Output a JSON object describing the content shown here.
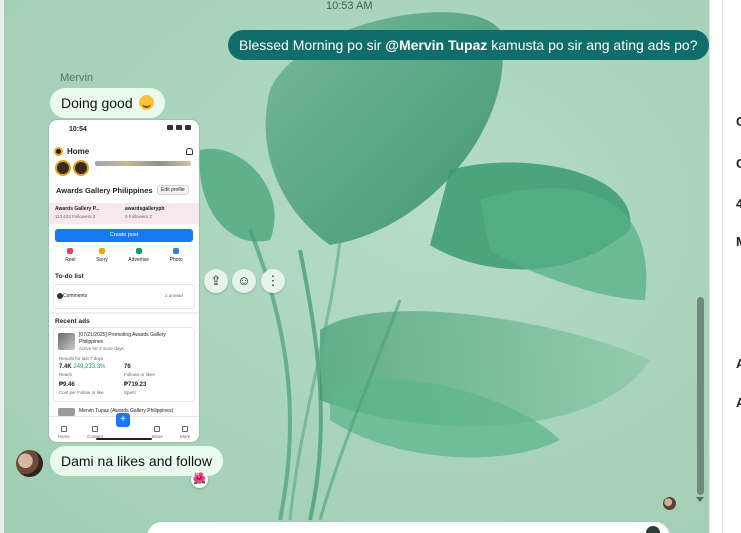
{
  "chat": {
    "timestamp": "10:53 AM",
    "outgoing": {
      "prefix": "Blessed Morning po sir ",
      "mention": "@Mervin Tupaz",
      "suffix": " kamusta po sir ang ating ads po?"
    },
    "sender_name": "Mervin",
    "message_1": "Doing good",
    "message_2": "Dami na likes and follow",
    "reaction": "🌺",
    "hover_actions": {
      "share_icon": "⇪",
      "react_icon": "☺",
      "more_icon": "⋮"
    }
  },
  "attachment": {
    "status_time": "10:54",
    "home_title": "Home",
    "page_name": "Awards Gallery Philippines",
    "edit_profile": "Edit profile",
    "fb_account": "Awards Gallery P...",
    "fb_followers": "113,634 Followers",
    "fb_count": "3",
    "ig_account": "awardsgalleryph",
    "ig_followers": "0 Followers",
    "ig_count": "2",
    "create_post": "Create post",
    "actions": [
      "Reel",
      "Story",
      "Advertise",
      "Photo"
    ],
    "action_colors": [
      "#e4405f",
      "#f0a419",
      "#1a9c5a",
      "#3b7be0"
    ],
    "todo_title": "To-do list",
    "todo_item": "Comments",
    "todo_meta": "1 unread",
    "recent_ads": "Recent ads",
    "ad_title": "[07/21/2025] Promoting Awards Gallery Philippines",
    "ad_status": "Active for 2 more days",
    "results_label": "Results for last 7 days",
    "metrics": [
      {
        "value": "7.4K",
        "delta": "249,233.3%",
        "label": "Reach"
      },
      {
        "value": "76",
        "delta": "",
        "label": "Follows or likes"
      },
      {
        "value": "₱9.46",
        "delta": "",
        "label": "Cost per Follow or like"
      },
      {
        "value": "₱719.23",
        "delta": "",
        "label": "Spent"
      }
    ],
    "ad2_title": "Mervin Tupaz (Awards Gallery Philippines)",
    "tabs": [
      "Home",
      "Content",
      "Inbox",
      "More"
    ],
    "fab": "+"
  },
  "right_panel": {
    "glyphs": [
      "C",
      "C",
      "4",
      "M",
      "A",
      "A"
    ]
  }
}
